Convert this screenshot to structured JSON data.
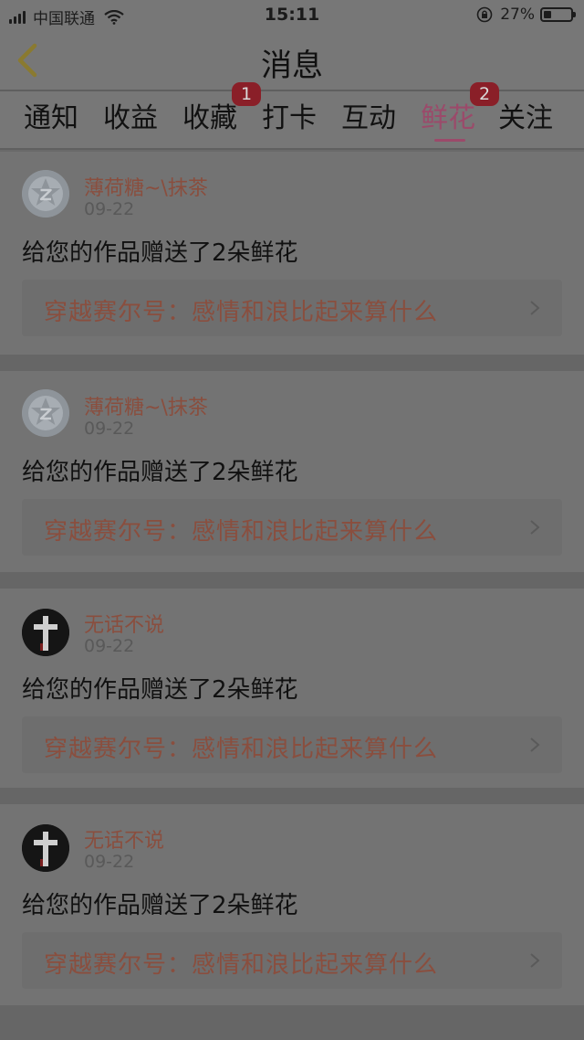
{
  "status_bar": {
    "carrier": "中国联通",
    "time": "15:11",
    "battery_percent": "27%",
    "battery_level": 0.27
  },
  "header": {
    "title": "消息"
  },
  "tabs": [
    {
      "label": "通知",
      "badge": ""
    },
    {
      "label": "收益",
      "badge": ""
    },
    {
      "label": "收藏",
      "badge": "1"
    },
    {
      "label": "打卡",
      "badge": ""
    },
    {
      "label": "互动",
      "badge": ""
    },
    {
      "label": "鲜花",
      "badge": "2",
      "active": true
    },
    {
      "label": "关注",
      "badge": ""
    }
  ],
  "feed": [
    {
      "user": "薄荷糖~\\抹茶",
      "date": "09-22",
      "message": "给您的作品赠送了2朵鲜花",
      "work_title": "穿越赛尔号：感情和浪比起来算什么",
      "avatar": "qq-default-avatar"
    },
    {
      "user": "薄荷糖~\\抹茶",
      "date": "09-22",
      "message": "给您的作品赠送了2朵鲜花",
      "work_title": "穿越赛尔号：感情和浪比起来算什么",
      "avatar": "qq-default-avatar"
    },
    {
      "user": "无话不说",
      "date": "09-22",
      "message": "给您的作品赠送了2朵鲜花",
      "work_title": "穿越赛尔号：感情和浪比起来算什么",
      "avatar": "cross-avatar"
    },
    {
      "user": "无话不说",
      "date": "09-22",
      "message": "给您的作品赠送了2朵鲜花",
      "work_title": "穿越赛尔号：感情和浪比起来算什么",
      "avatar": "cross-avatar"
    }
  ],
  "colors": {
    "accent": "#9b4a6a",
    "badge": "#8a1f28",
    "username": "#8a4e3e"
  }
}
